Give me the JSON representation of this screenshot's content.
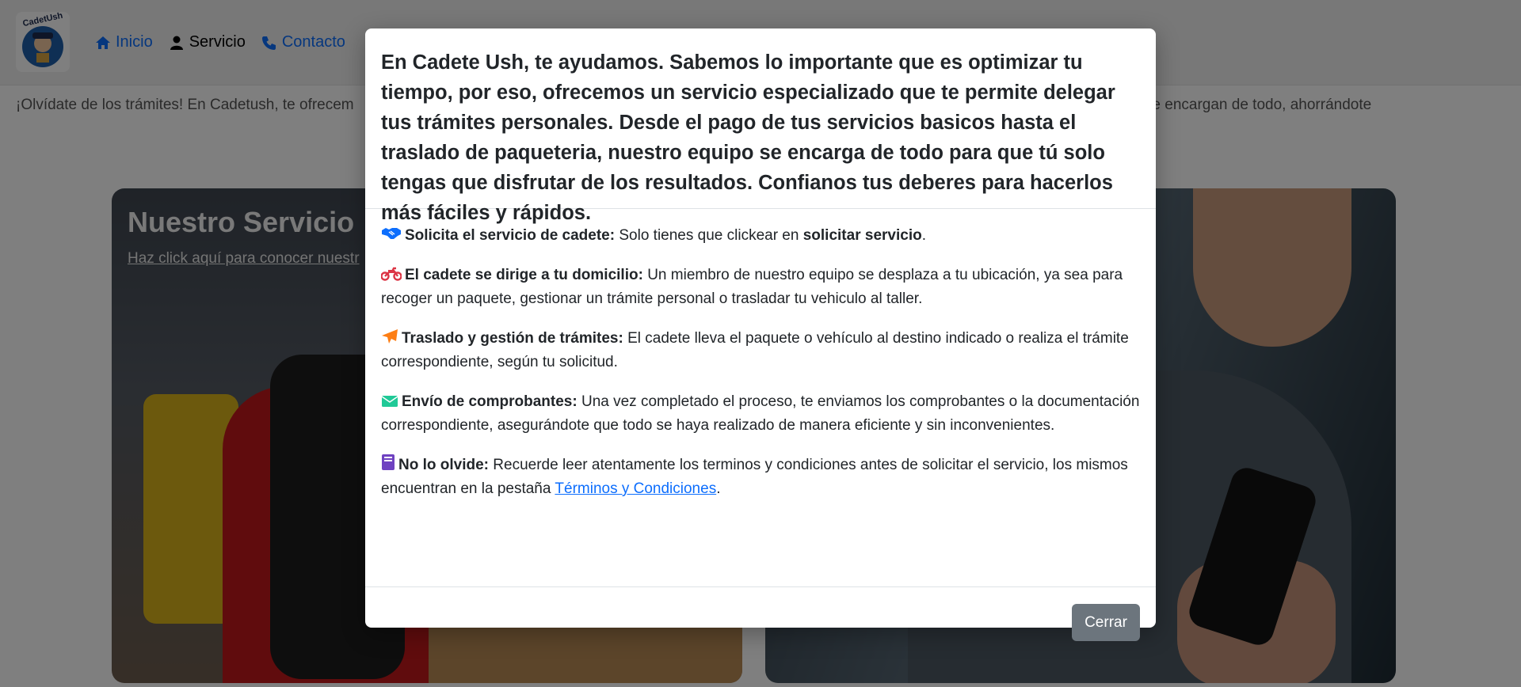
{
  "brand": {
    "logo_text": "CadetUsh"
  },
  "nav": {
    "items": [
      {
        "label": "Inicio",
        "icon": "home-icon"
      },
      {
        "label": "Servicio",
        "icon": "user-icon"
      },
      {
        "label": "Contacto",
        "icon": "phone-icon"
      }
    ]
  },
  "intro_text": "¡Olvídate de los trámites! En Cadetush, te ofrecem",
  "intro_text_right": "stros cadetes se encargan de todo, ahorrándote",
  "card": {
    "title": "Nuestro Servicio",
    "link": "Haz click aquí para conocer nuestr"
  },
  "modal": {
    "intro": "En Cadete Ush, te ayudamos. Sabemos lo importante que es optimizar tu tiempo, por eso, ofrecemos un servicio especializado que te permite delegar tus trámites personales. Desde el pago de tus servicios basicos hasta el traslado de paqueteria, nuestro equipo se encarga de todo para que tú solo tengas que disfrutar de los resultados. Confianos tus deberes para hacerlos más fáciles y rápidos.",
    "steps": [
      {
        "icon": "handshake-icon",
        "title": "Solicita el servicio de cadete:",
        "text": "Solo tienes que clickear en",
        "strong": "solicitar servicio",
        "after": "."
      },
      {
        "icon": "motorcycle-icon",
        "title": "El cadete se dirige a tu domicilio:",
        "text": "Un miembro de nuestro equipo se desplaza a tu ubicación, ya sea para recoger un paquete, gestionar un trámite personal o trasladar tu vehiculo al taller."
      },
      {
        "icon": "paper-plane-icon",
        "title": "Traslado y gestión de trámites:",
        "text": "El cadete lleva el paquete o vehículo al destino indicado o realiza el trámite correspondiente, según tu solicitud."
      },
      {
        "icon": "envelope-icon",
        "title": "Envío de comprobantes:",
        "text": "Una vez completado el proceso, te enviamos los comprobantes o la documentación correspondiente, asegurándote que todo se haya realizado de manera eficiente y sin inconvenientes."
      },
      {
        "icon": "book-icon",
        "title": "No lo olvide:",
        "text": "Recuerde leer atentamente los terminos y condiciones antes de solicitar el servicio, los mismos encuentran en la pestaña",
        "link": "Términos y Condiciones",
        "after": "."
      }
    ],
    "close_label": "Cerrar"
  },
  "colors": {
    "link": "#0d6efd",
    "close_button": "#6c757d",
    "handshake": "#0d6efd",
    "motorcycle": "#dc3545",
    "paper_plane": "#fd7e14",
    "envelope": "#20c997",
    "book": "#6f42c1"
  }
}
